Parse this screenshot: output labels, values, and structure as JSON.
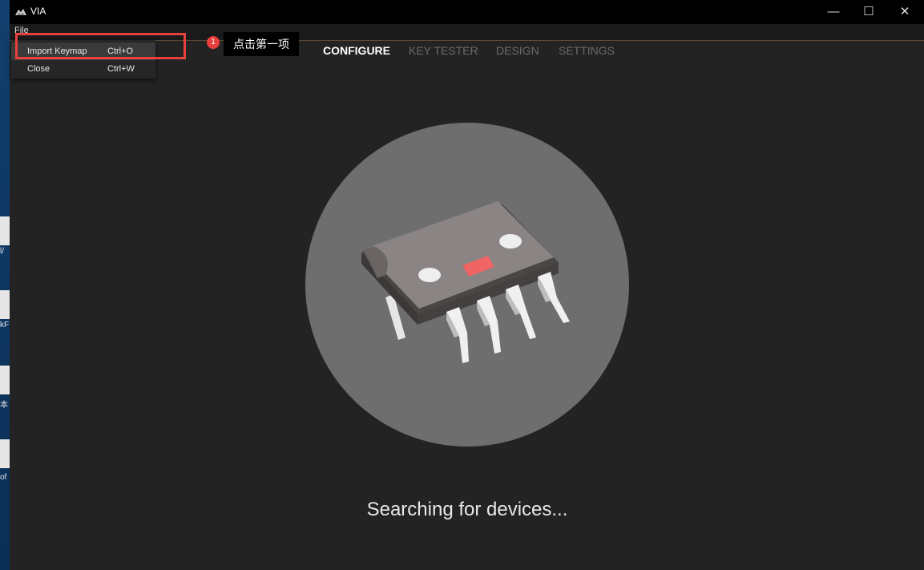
{
  "window": {
    "title": "VIA",
    "controls": {
      "minimize": "—",
      "maximize": "☐",
      "close": "✕"
    }
  },
  "menubar": {
    "file": "File"
  },
  "dropdown": {
    "items": [
      {
        "label": "Import Keymap",
        "shortcut": "Ctrl+O",
        "highlighted": true
      },
      {
        "label": "Close",
        "shortcut": "Ctrl+W",
        "highlighted": false
      }
    ]
  },
  "annotation": {
    "badge": "1",
    "tooltip": "点击第一项",
    "color": "#e8403c"
  },
  "tabs": [
    {
      "label": "CONFIGURE",
      "active": true
    },
    {
      "label": "KEY TESTER",
      "active": false
    },
    {
      "label": "DESIGN",
      "active": false
    },
    {
      "label": "SETTINGS",
      "active": false
    }
  ],
  "illustration": {
    "icon": "chip-icon",
    "accent_color": "#f06464"
  },
  "status": {
    "text": "Searching for devices..."
  },
  "desktop_fragments": [
    "l/",
    "kF",
    "本",
    "of"
  ]
}
